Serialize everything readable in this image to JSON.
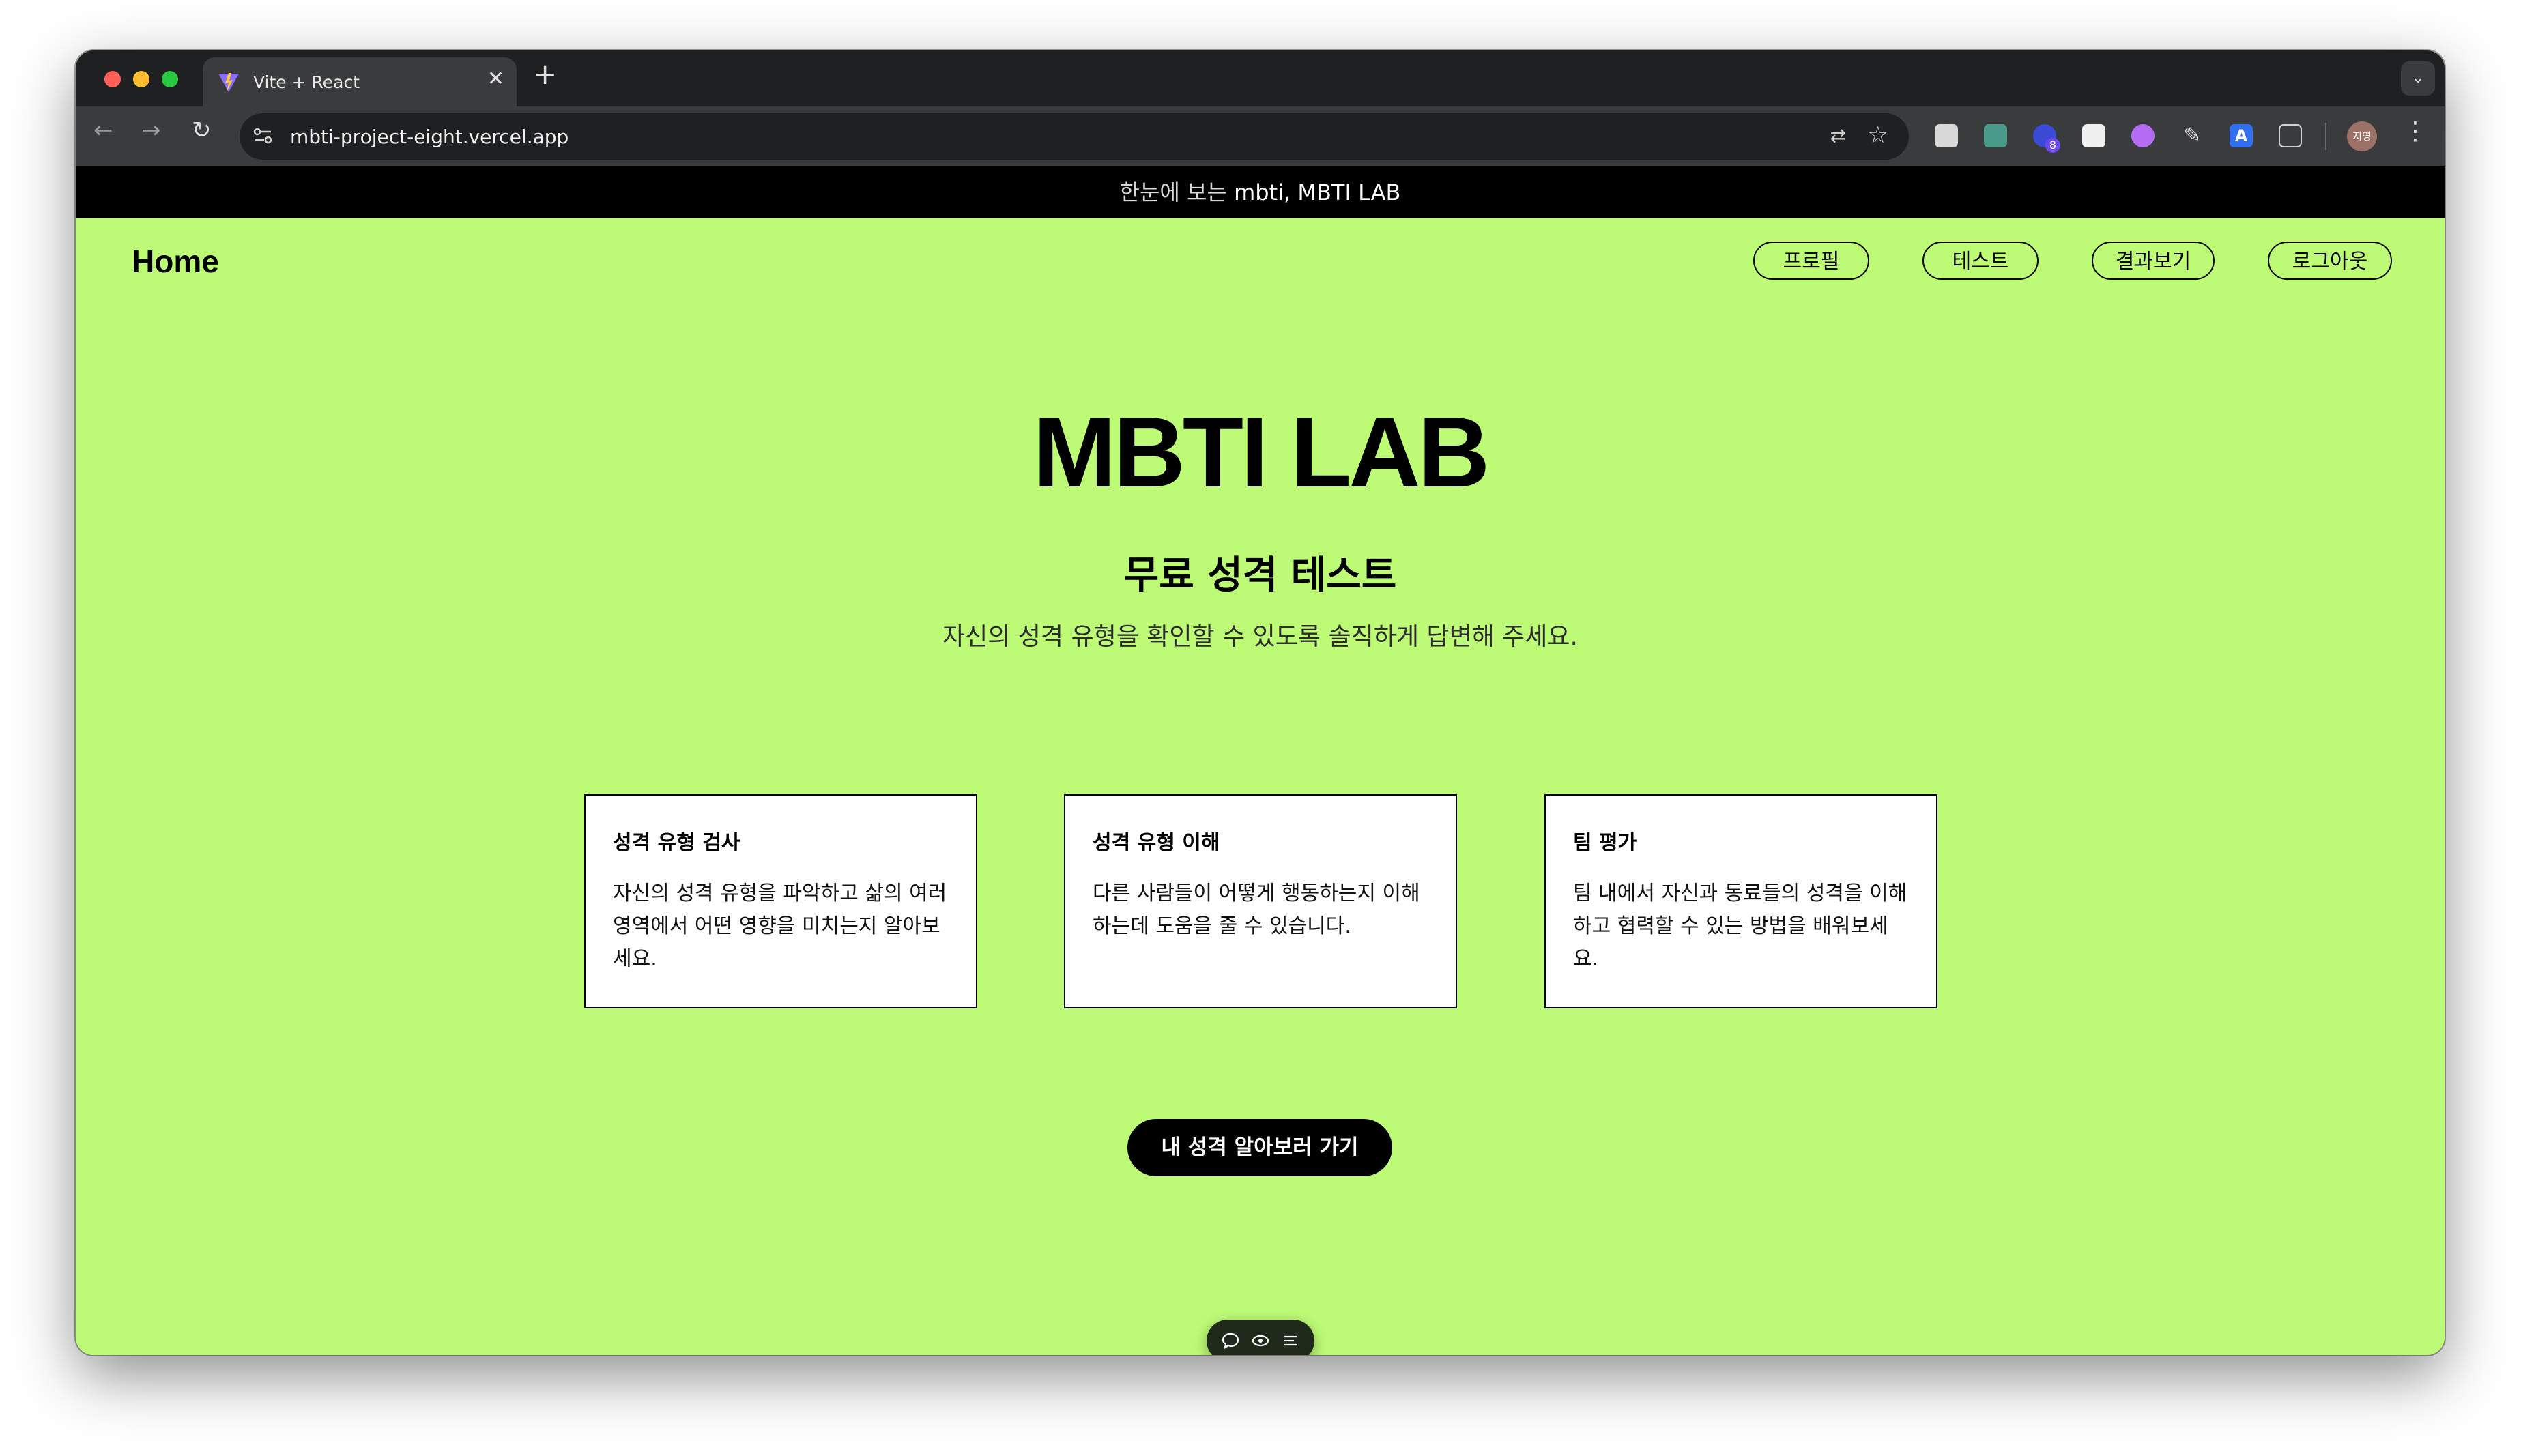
{
  "browser": {
    "tab_title": "Vite + React",
    "url": "mbti-project-eight.vercel.app",
    "profile_initials": "지영",
    "extension_badge_count": "8"
  },
  "announcement": {
    "prefix": "한눈에 보는",
    "text": "mbti, MBTI LAB"
  },
  "header": {
    "home": "Home",
    "nav": [
      "프로필",
      "테스트",
      "결과보기",
      "로그아웃"
    ]
  },
  "hero": {
    "title": "MBTI LAB",
    "subtitle": "무료 성격 테스트",
    "description": "자신의 성격 유형을 확인할 수 있도록 솔직하게 답변해 주세요."
  },
  "cards": [
    {
      "title": "성격 유형 검사",
      "body": "자신의 성격 유형을 파악하고 삶의 여러 영역에서 어떤 영향을 미치는지 알아보세요."
    },
    {
      "title": "성격 유형 이해",
      "body": "다른 사람들이 어떻게 행동하는지 이해하는데 도움을 줄 수 있습니다."
    },
    {
      "title": "팀 평가",
      "body": "팀 내에서 자신과 동료들의 성격을 이해하고 협력할 수 있는 방법을 배워보세요."
    }
  ],
  "cta": {
    "label": "내 성격 알아보러 가기"
  },
  "colors": {
    "page_background": "#bdfa76",
    "card_background": "#ffffff",
    "cta_background": "#000000",
    "announcement_background": "#000000"
  },
  "icons": {
    "floating_toolbar": [
      "comment-icon",
      "eye-icon",
      "list-icon"
    ]
  }
}
